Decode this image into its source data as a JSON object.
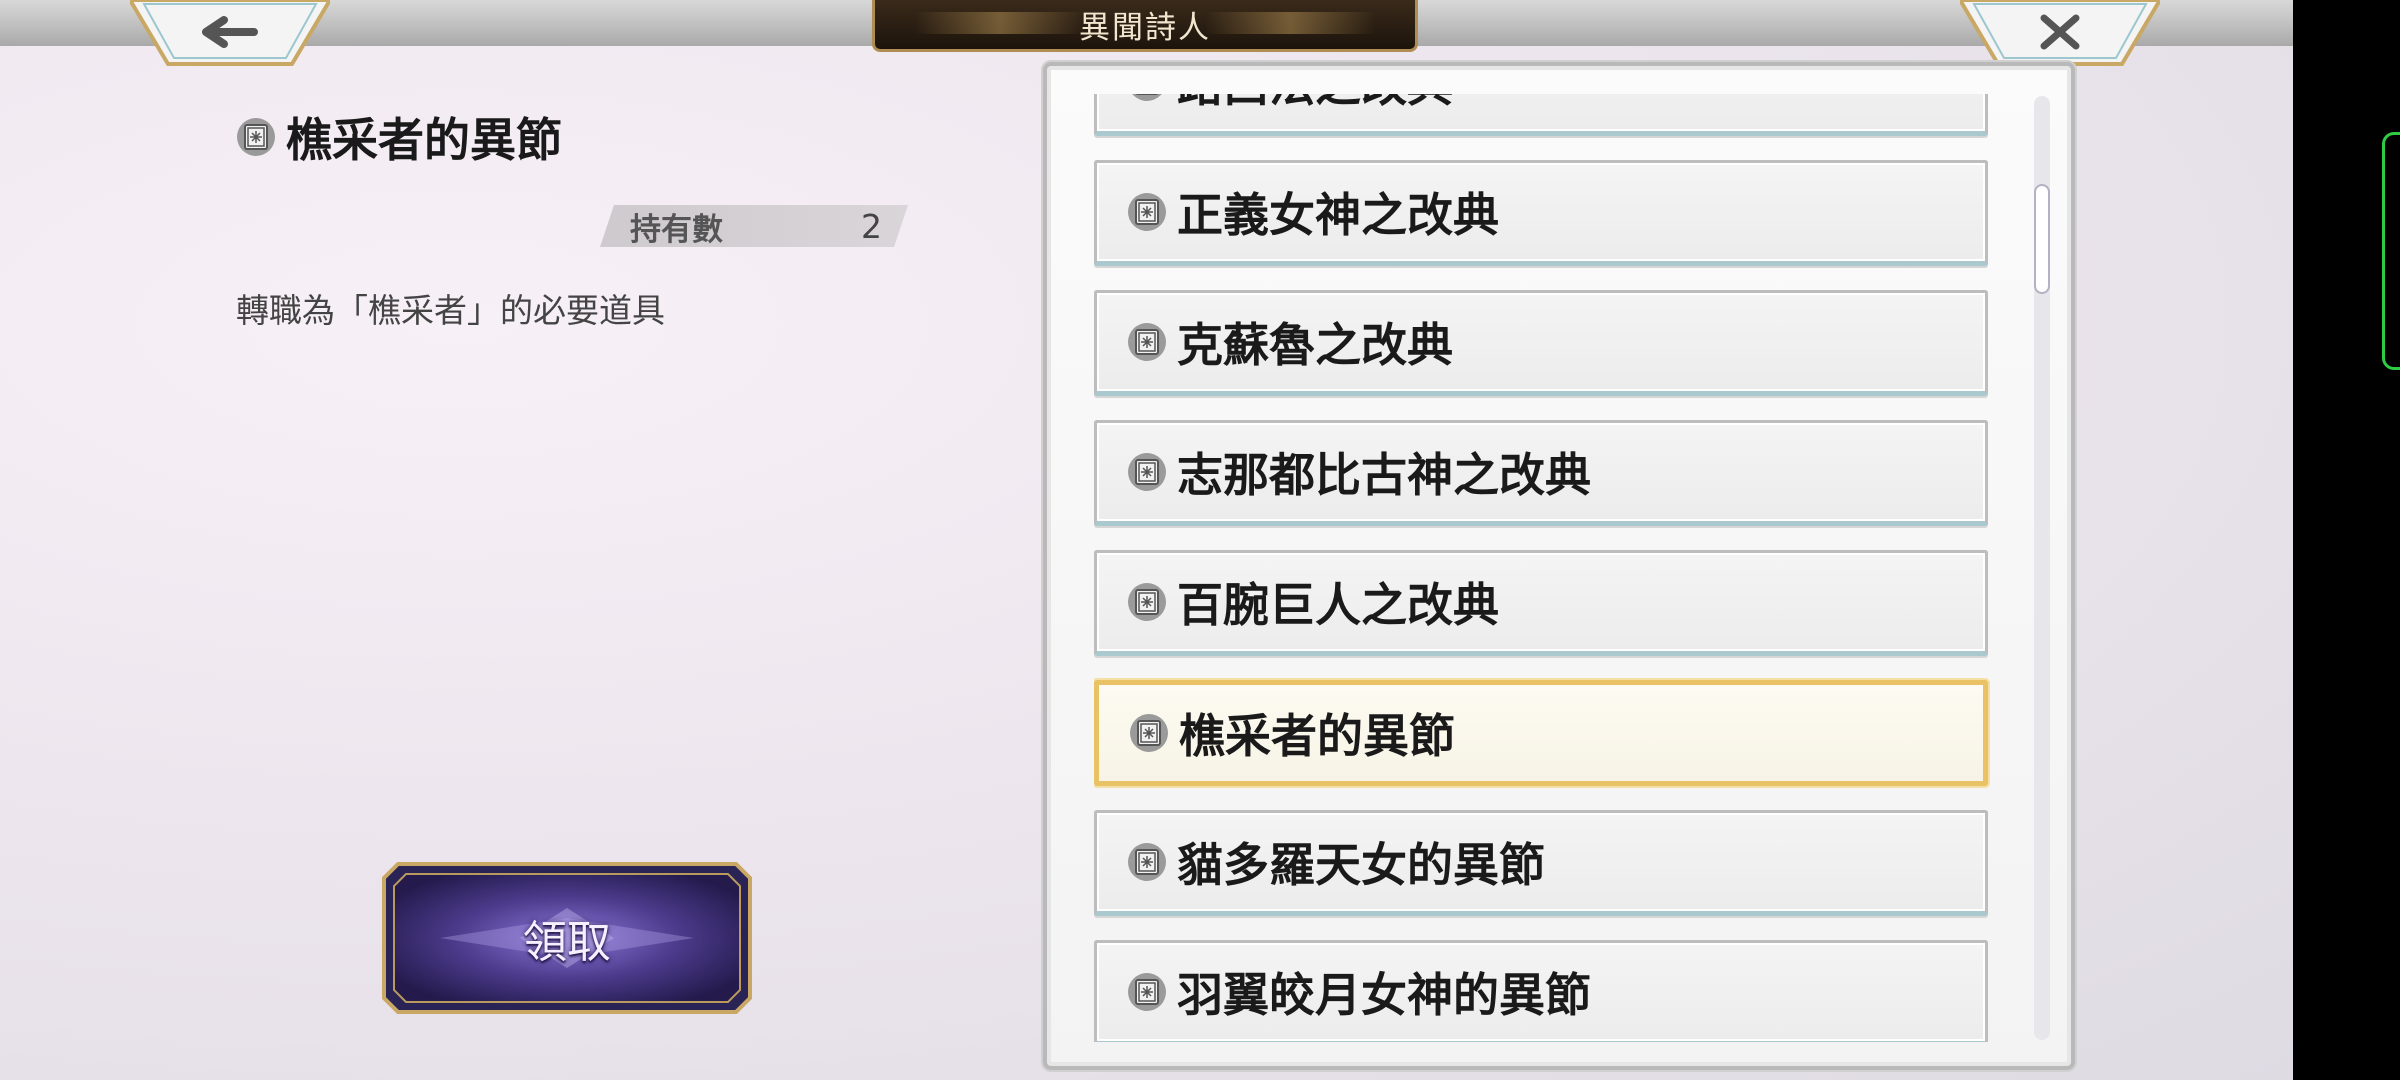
{
  "title": "異聞詩人",
  "detail": {
    "name": "樵采者的異節",
    "count_label": "持有數",
    "count_value": "2",
    "description": "轉職為「樵采者」的必要道具"
  },
  "claim_button": "領取",
  "icons": {
    "back": "arrow-left-icon",
    "close": "close-icon",
    "item": "book-icon"
  },
  "colors": {
    "selected_border": "#e9c265",
    "title_plate": "#1c140c",
    "claim_button": "#4a3a8a"
  },
  "list": {
    "items": [
      {
        "label": "路西法之改典"
      },
      {
        "label": "正義女神之改典"
      },
      {
        "label": "克蘇魯之改典"
      },
      {
        "label": "志那都比古神之改典"
      },
      {
        "label": "百腕巨人之改典"
      },
      {
        "label": "樵采者的異節",
        "selected": true
      },
      {
        "label": "貓多羅天女的異節"
      },
      {
        "label": "羽翼皎月女神的異節"
      }
    ]
  }
}
